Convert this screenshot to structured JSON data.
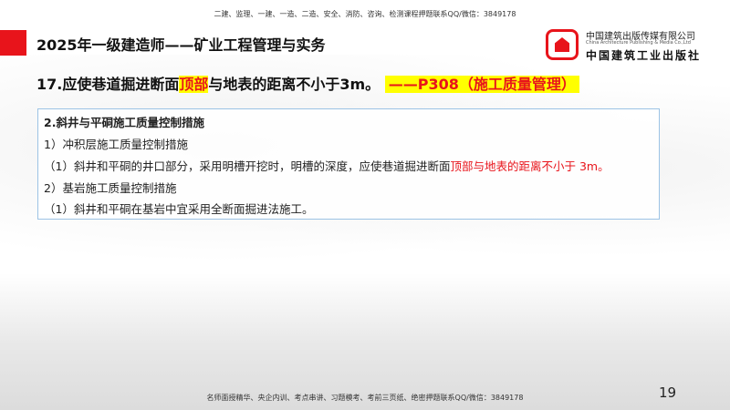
{
  "header_note": "二建、监理、一建、一造、二造、安全、消防、咨询、检测课程押题联系QQ/微信：3849178",
  "footer_note": "名师面授精华、央企内训、考点串讲、习题模考、考前三页纸、绝密押题联系QQ/微信：3849178",
  "title": "2025年一级建造师——矿业工程管理与实务",
  "question": {
    "prefix": "17.应使巷道掘进断面",
    "highlight": "顶部",
    "suffix": "与地表的距离不小于3m。",
    "reference": "——P308（施工质量管理）"
  },
  "box": {
    "heading": "2.斜井与平硐施工质量控制措施",
    "line1": "1）冲积层施工质量控制措施",
    "line2_prefix": "（1）斜井和平硐的井口部分，采用明槽开挖时，明槽的深度，应使巷道掘进断面",
    "line2_red": "顶部与地表的距离不小于 3m。",
    "line3": "2）基岩施工质量控制措施",
    "line4": "（1）斜井和平硐在基岩中宜采用全断面掘进法施工。"
  },
  "logo": {
    "cn": "中国建筑出版传媒有限公司",
    "en": "China Architecture Publishing & Media Co.,Ltd",
    "cn2": "中国建筑工业出版社"
  },
  "page_number": "19",
  "colors": {
    "accent": "#e8141b",
    "highlight": "#ffff00",
    "box_border": "#9cc3e5"
  }
}
